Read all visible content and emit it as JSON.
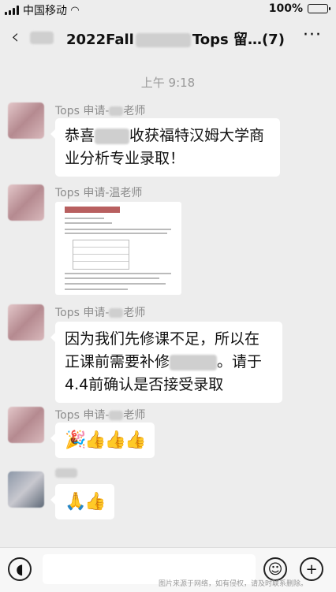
{
  "status_bar": {
    "carrier": "中国移动",
    "battery_percent": "100%",
    "battery_level": 1.0
  },
  "nav": {
    "back_icon": "‹",
    "title_prefix": "2022Fall",
    "title_suffix": "Tops 留…(7)",
    "more_icon": "···"
  },
  "chat": {
    "timestamp": "上午 9:18",
    "messages": [
      {
        "sender": "Tops 申请-",
        "sender_suffix": "老师",
        "text_a": "恭喜",
        "text_b": "收获福特汉姆大学商业分析专业录取！"
      },
      {
        "sender": "Tops 申请-温老师",
        "attachment": "document-image"
      },
      {
        "sender": "Tops 申请-",
        "sender_suffix": "老师",
        "text_a": "因为我们先修课不足，所以在正课前需要补修",
        "text_b": "。请于4.4前确认是否接受录取"
      },
      {
        "sender": "Tops 申请-",
        "sender_suffix": "老师",
        "emoji": "🎉👍👍👍"
      },
      {
        "sender": "",
        "emoji": "🙏👍"
      }
    ]
  },
  "input_bar": {
    "voice_icon": "voice-icon",
    "emoji_icon": "smiley-icon",
    "plus_icon": "plus-icon",
    "watermark": "图片来源于网络，如有侵权，请及时联系删除。"
  }
}
